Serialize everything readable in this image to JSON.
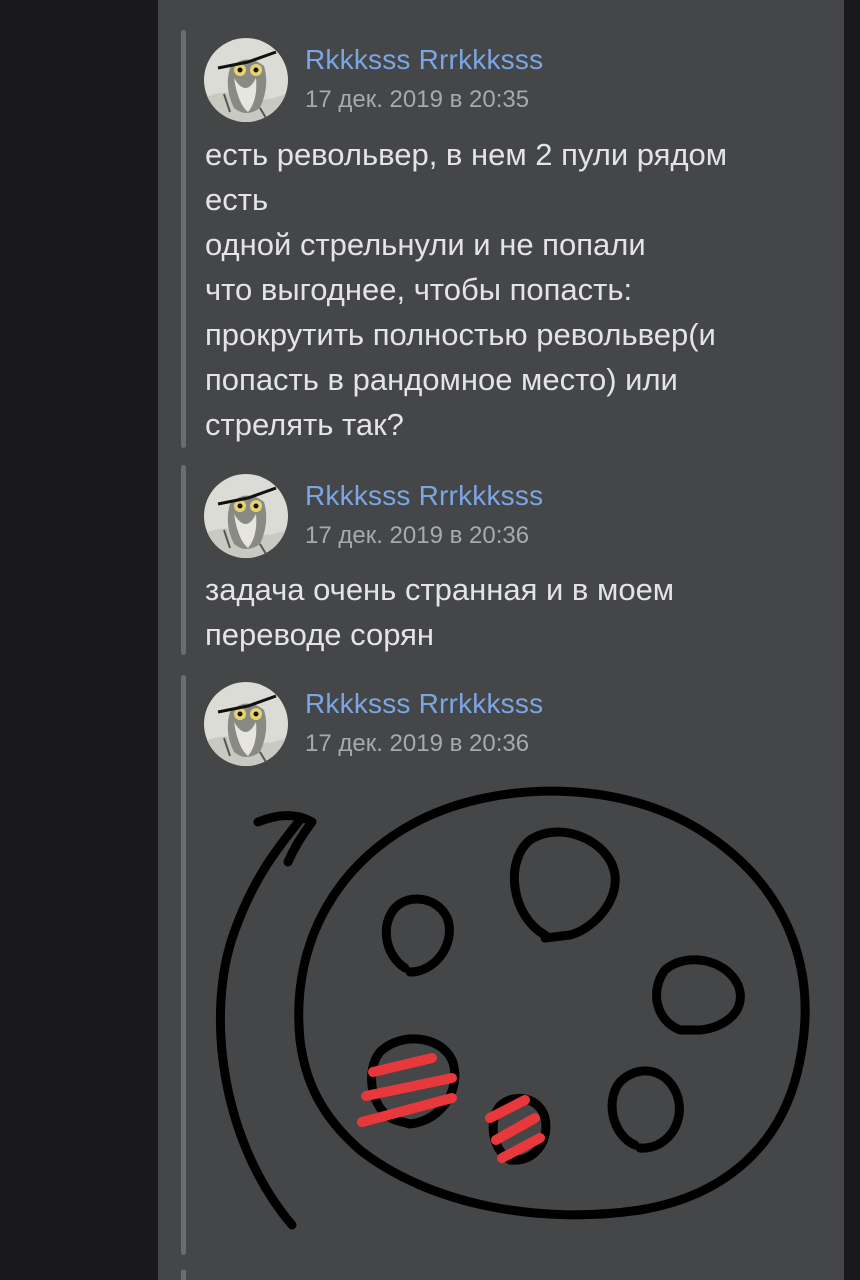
{
  "messages": [
    {
      "author": "Rkkksss Rrrkkksss",
      "date": "17 дек. 2019 в 20:35",
      "text": "есть револьвер, в нем 2 пули рядом\nесть\nодной стрельнули и не попали\nчто выгоднее, чтобы попасть:\nпрокрутить полностью револьвер(и\nпопасть в рандомное место) или\nстрелять так?"
    },
    {
      "author": "Rkkksss Rrrkkksss",
      "date": "17 дек. 2019 в 20:36",
      "text": "задача очень странная и в моем\nпереводе сорян"
    },
    {
      "author": "Rkkksss Rrrkkksss",
      "date": "17 дек. 2019 в 20:36",
      "attachment": "revolver-cylinder-drawing"
    }
  ],
  "colors": {
    "panel_bg": "#454648",
    "author_link": "#7aa6e6",
    "date_text": "#a8a9ac",
    "message_text": "#e4e4e6",
    "ink": "#000000",
    "bullet_marker": "#e8383b"
  }
}
